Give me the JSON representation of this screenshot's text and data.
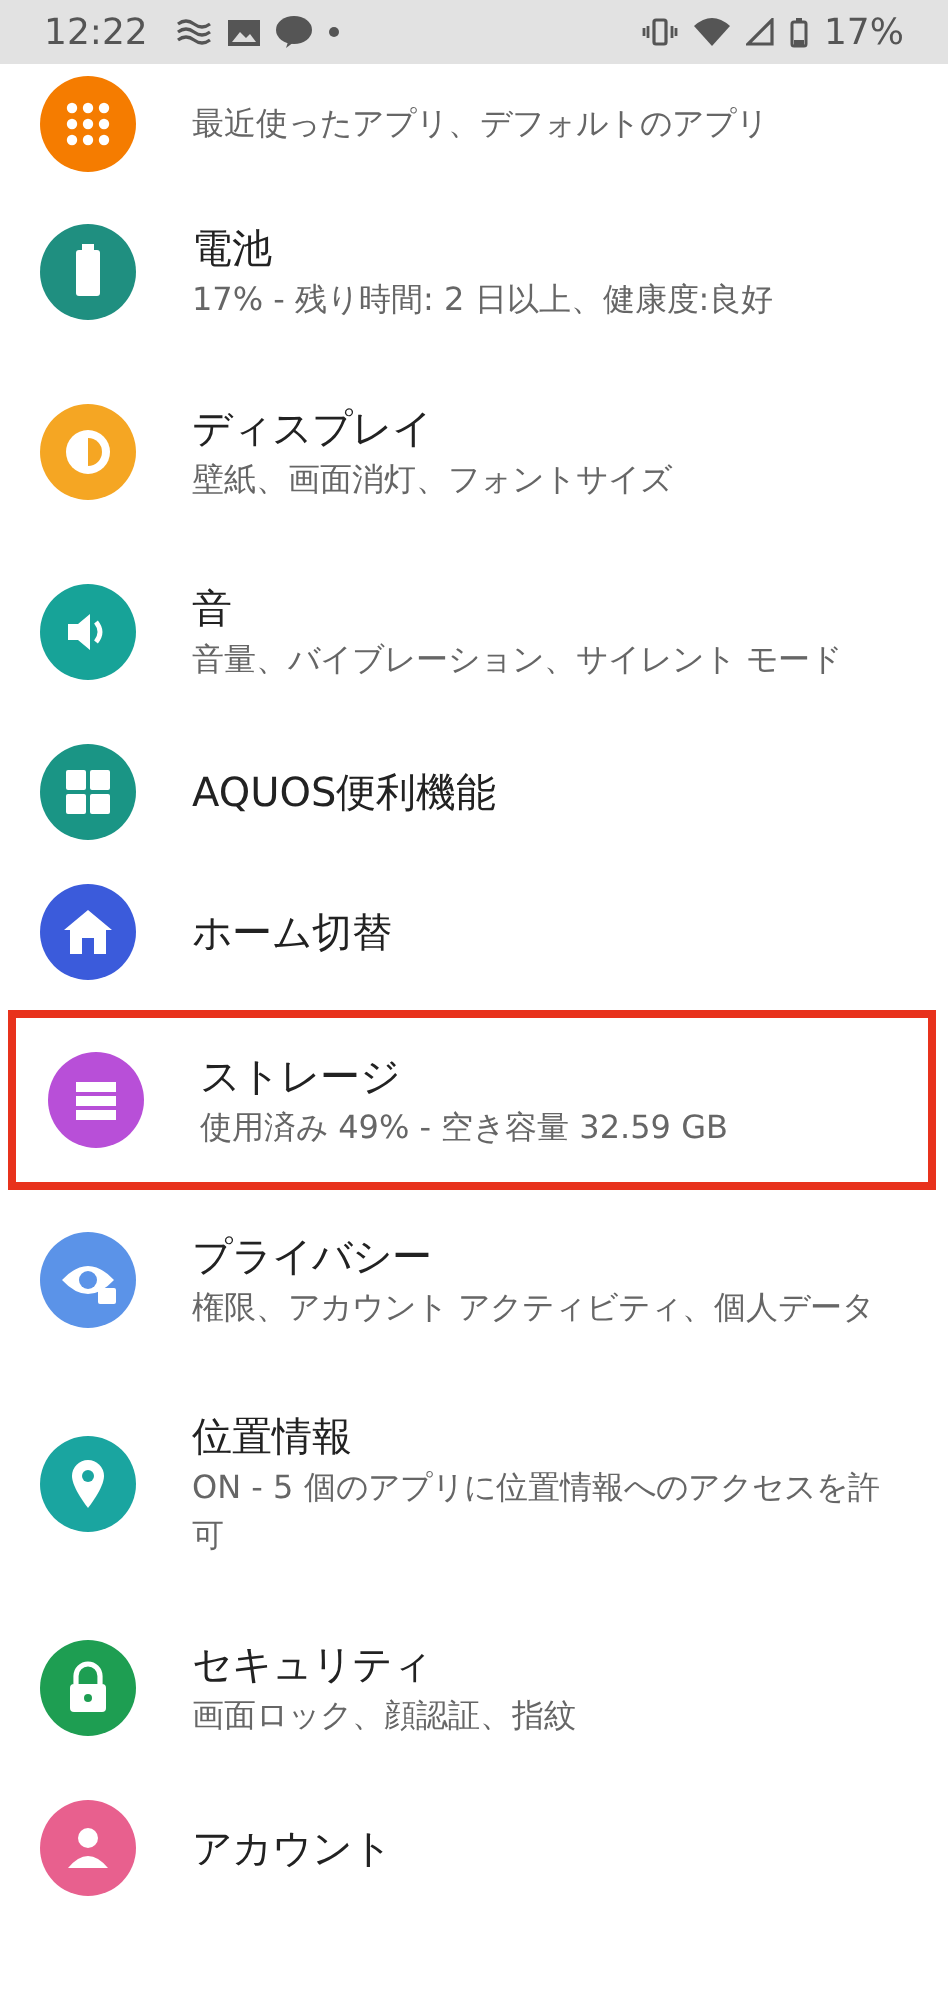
{
  "status_bar": {
    "time": "12:22",
    "battery": "17%"
  },
  "items": [
    {
      "subtitle": "最近使ったアプリ、デフォルトのアプリ",
      "color": "#f57c00",
      "highlighted": false
    },
    {
      "title": "電池",
      "subtitle": "17% - 残り時間: 2 日以上、健康度:良好",
      "color": "#1f8f80",
      "highlighted": false
    },
    {
      "title": "ディスプレイ",
      "subtitle": "壁紙、画面消灯、フォントサイズ",
      "color": "#f5a623",
      "highlighted": false
    },
    {
      "title": "音",
      "subtitle": "音量、バイブレーション、サイレント モード",
      "color": "#17a398",
      "highlighted": false
    },
    {
      "title": "AQUOS便利機能",
      "color": "#1a9585",
      "highlighted": false
    },
    {
      "title": "ホーム切替",
      "color": "#3b5bdb",
      "highlighted": false
    },
    {
      "title": "ストレージ",
      "subtitle": "使用済み 49% - 空き容量 32.59 GB",
      "color": "#b84fd8",
      "highlighted": true
    },
    {
      "title": "プライバシー",
      "subtitle": "権限、アカウント アクティビティ、個人データ",
      "color": "#5b93e8",
      "highlighted": false
    },
    {
      "title": "位置情報",
      "subtitle": "ON - 5 個のアプリに位置情報へのアクセスを許可",
      "color": "#1aa5a0",
      "highlighted": false
    },
    {
      "title": "セキュリティ",
      "subtitle": "画面ロック、顔認証、指紋",
      "color": "#1e9e52",
      "highlighted": false
    },
    {
      "title": "アカウント",
      "color": "#e8608e",
      "highlighted": false
    }
  ]
}
